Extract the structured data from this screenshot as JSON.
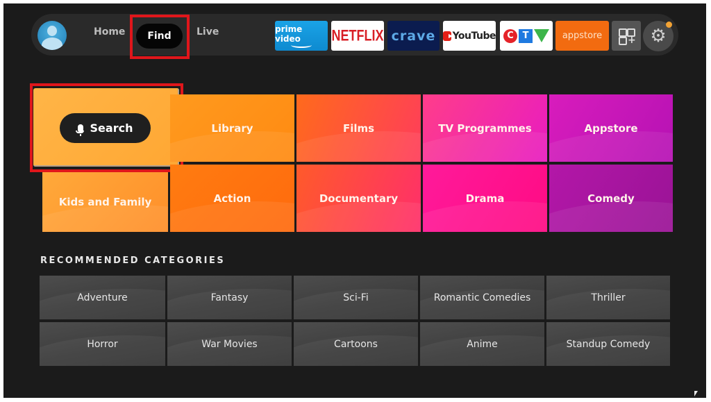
{
  "nav": {
    "profile": "profile-avatar",
    "links": [
      {
        "label": "Home"
      },
      {
        "label": "Find",
        "selected": true
      },
      {
        "label": "Live"
      }
    ],
    "apps": [
      {
        "name": "prime video",
        "bg": "#1aa3e6"
      },
      {
        "name": "NETFLIX",
        "bg": "#ffffff",
        "fg": "#d81f26"
      },
      {
        "name": "CRAVE",
        "display": "crave",
        "bg": "#0b1c4f",
        "fg": "#5da9e6"
      },
      {
        "name": "YouTube",
        "bg": "#ffffff"
      },
      {
        "name": "CTV",
        "letters": [
          "C",
          "T",
          "V"
        ],
        "bg": "#ffffff"
      },
      {
        "name": "appstore",
        "bg": "#f26b10"
      }
    ],
    "all_apps_icon": "apps-grid-plus-icon",
    "settings_icon": "gear-icon",
    "notification_dot_color": "#f2a234"
  },
  "highlight_color": "#e0161b",
  "categories": [
    {
      "label": "Search",
      "icon": "microphone-icon",
      "focused": true
    },
    {
      "label": "Library"
    },
    {
      "label": "Films"
    },
    {
      "label": "TV Programmes"
    },
    {
      "label": "Appstore"
    },
    {
      "label": "Kids and Family"
    },
    {
      "label": "Action"
    },
    {
      "label": "Documentary"
    },
    {
      "label": "Drama"
    },
    {
      "label": "Comedy"
    }
  ],
  "recommended": {
    "title": "RECOMMENDED CATEGORIES",
    "items": [
      {
        "label": "Adventure"
      },
      {
        "label": "Fantasy"
      },
      {
        "label": "Sci-Fi"
      },
      {
        "label": "Romantic Comedies"
      },
      {
        "label": "Thriller"
      },
      {
        "label": "Horror"
      },
      {
        "label": "War Movies"
      },
      {
        "label": "Cartoons"
      },
      {
        "label": "Anime"
      },
      {
        "label": "Standup Comedy"
      }
    ]
  }
}
